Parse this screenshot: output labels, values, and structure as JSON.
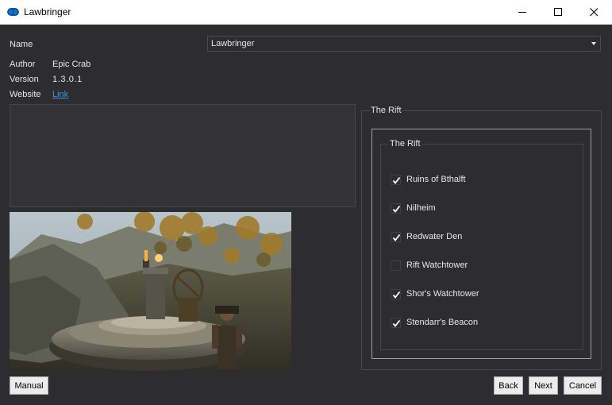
{
  "window": {
    "title": "Lawbringer",
    "icon": "app-icon"
  },
  "header": {
    "name_label": "Name",
    "name_value": "Lawbringer",
    "author_label": "Author",
    "author_value": "Epic Crab",
    "version_label": "Version",
    "version_value": "1.3.0.1",
    "website_label": "Website",
    "website_link": "Link"
  },
  "description": "",
  "options_panel": {
    "group_title": "The Rift",
    "inner_group_title": "The Rift",
    "items": [
      {
        "label": "Ruins of Bthalft",
        "checked": true
      },
      {
        "label": "Nilheim",
        "checked": true
      },
      {
        "label": "Redwater Den",
        "checked": true
      },
      {
        "label": "Rift Watchtower",
        "checked": false
      },
      {
        "label": "Shor's Watchtower",
        "checked": true
      },
      {
        "label": "Stendarr's Beacon",
        "checked": true
      }
    ]
  },
  "buttons": {
    "manual": "Manual",
    "back": "Back",
    "next": "Next",
    "cancel": "Cancel"
  },
  "colors": {
    "background": "#2d2d30",
    "text": "#e6e6e6",
    "link": "#3a96dd",
    "app_icon": "#0078d7"
  }
}
